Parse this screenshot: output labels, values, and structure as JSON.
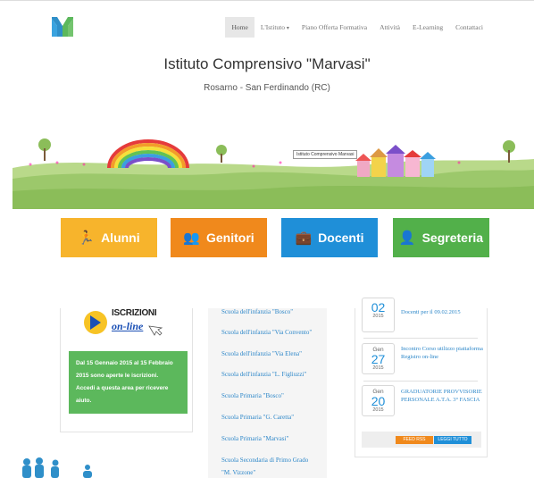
{
  "nav": {
    "items": [
      {
        "label": "Home"
      },
      {
        "label": "L'Istituto"
      },
      {
        "label": "Piano Offerta Formativa"
      },
      {
        "label": "Attività"
      },
      {
        "label": "E-Learning"
      },
      {
        "label": "Contattaci"
      }
    ],
    "dropdown_caret": "▾"
  },
  "header": {
    "title": "Istituto Comprensivo \"Marvasi\"",
    "subtitle": "Rosarno - San Ferdinando (RC)"
  },
  "banner": {
    "label": "Istituto Comprensivo Marvasi"
  },
  "sections": [
    {
      "label": "Alunni",
      "icon": "person-icon",
      "color": "#f7b42c"
    },
    {
      "label": "Genitori",
      "icon": "users-icon",
      "color": "#f0891c"
    },
    {
      "label": "Docenti",
      "icon": "briefcase-icon",
      "color": "#1f8fd8"
    },
    {
      "label": "Segreteria",
      "icon": "user-desk-icon",
      "color": "#52b04a"
    }
  ],
  "iscrizioni": {
    "title": "ISCRIZIONI",
    "subtitle": "on-line",
    "notice_lines": [
      "Dal 15 Gennaio 2015 al 15 Febbraio",
      "2015 sono aperte le iscrizioni.",
      "Accedi a questa area per ricevere",
      "aiuto."
    ]
  },
  "schools": [
    "Scuola dell'infanzia \"Bosco\"",
    "Scuola dell'infanzia \"Via Convento\"",
    "Scuola dell'infanzia \"Via Elena\"",
    "Scuola dell'infanzia \"L. Figliuzzi\"",
    "Scuola Primaria \"Bosco\"",
    "Scuola Primaria \"G. Caretta\"",
    "Scuola Primaria \"Marvasi\"",
    "Scuola Secondaria di Primo Grado",
    "\"M. Vizzone\""
  ],
  "events": [
    {
      "month": "",
      "day": "02",
      "year": "2015",
      "text": "Docenti per il 09.02.2015"
    },
    {
      "month": "Gen",
      "day": "27",
      "year": "2015",
      "text": "Incontro Corso utilizzo piattaforma Registro on-line"
    },
    {
      "month": "Gen",
      "day": "20",
      "year": "2015",
      "text": "GRADUATORIE PROVVISORIE PERSONALE A.T.A. 3° FASCIA"
    }
  ],
  "feed": {
    "rss_label": "FEED RSS",
    "read_all_label": "LEGGI TUTTO"
  },
  "colors": {
    "accent": "#1f8fd8",
    "link": "#2d87c9",
    "green": "#5cb85c"
  }
}
